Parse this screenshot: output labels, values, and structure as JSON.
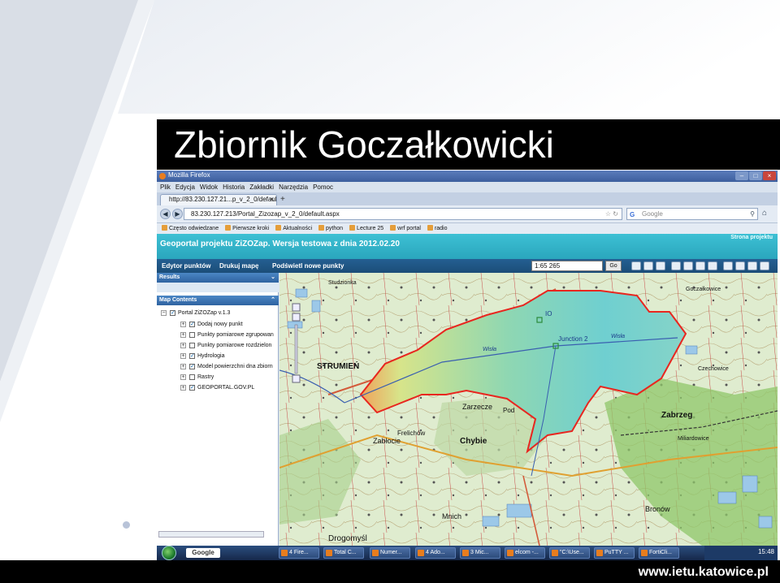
{
  "slide": {
    "title": "Zbiornik Goczałkowicki",
    "footer_url": "www.ietu.katowice.pl"
  },
  "browser": {
    "window_title": "Mozilla Firefox",
    "menu": [
      "Plik",
      "Edycja",
      "Widok",
      "Historia",
      "Zakładki",
      "Narzędzia",
      "Pomoc"
    ],
    "tab_label": "http://83.230.127.21...p_v_2_0/default.aspx",
    "url": "83.230.127.213/Portal_Zizozap_v_2_0/default.aspx",
    "search_placeholder": "Google",
    "bookmarks": [
      "Często odwiedzane",
      "Pierwsze kroki",
      "Aktualności",
      "python",
      "Lecture 25",
      "wrf portal",
      "radio"
    ]
  },
  "portal": {
    "header_title": "Geoportal projektu ZiZOZap. Wersja testowa z dnia 2012.02.20",
    "header_link": "Strona projektu",
    "toolbar_links": [
      "Edytor punktów",
      "Drukuj mapę",
      "Podświetl nowe punkty"
    ],
    "scale_value": "1:65 265",
    "go_label": "Go"
  },
  "sidebar": {
    "results_label": "Results",
    "map_contents_label": "Map Contents",
    "tree": [
      {
        "label": "Portal ZiZOZap v.1.3",
        "checked": true,
        "level": 0
      },
      {
        "label": "Dodaj nowy punkt",
        "checked": true,
        "level": 1
      },
      {
        "label": "Punkty pomiarowe zgrupowan",
        "checked": false,
        "level": 1
      },
      {
        "label": "Punkty pomiarowe rozdzielon",
        "checked": false,
        "level": 1
      },
      {
        "label": "Hydrologia",
        "checked": true,
        "level": 1
      },
      {
        "label": "Model powierzchni dna zbiorn",
        "checked": true,
        "level": 1
      },
      {
        "label": "Rastry",
        "checked": false,
        "level": 1
      },
      {
        "label": "GEOPORTAL.GOV.PL",
        "checked": true,
        "level": 1
      }
    ]
  },
  "map": {
    "labels": {
      "strumien": "STRUMIEŃ",
      "junction": "Junction 2",
      "io": "IO",
      "wisla_1": "Wisła",
      "wisla_2": "Wisła",
      "zarzecze": "Zarzecze",
      "zabrzeg": "Zabrzeg",
      "chybie": "Chybie",
      "frelichow": "Frelichów",
      "zablocie": "Zabłocie",
      "mnich": "Mnich",
      "drogomysl": "Drogomyśl",
      "bronow": "Bronów",
      "czechowice": "Czechowice",
      "goczalkowice": "Goczałkowice",
      "studzienki": "Studzionka",
      "milardowice": "Miliardowice",
      "pod": "Pod"
    },
    "colors": {
      "boundary": "#e8261f",
      "water_fill": "#7fd6c4",
      "river": "#3a5fb0"
    }
  },
  "taskbar": {
    "google": "Google",
    "items": [
      "4 Fire...",
      "Total C...",
      "Numer...",
      "4 Ado...",
      "3 Mic...",
      "elcom -...",
      "\"C:\\Use...",
      "PuTTY ...",
      "FortiCli..."
    ],
    "clock": "15:48"
  }
}
